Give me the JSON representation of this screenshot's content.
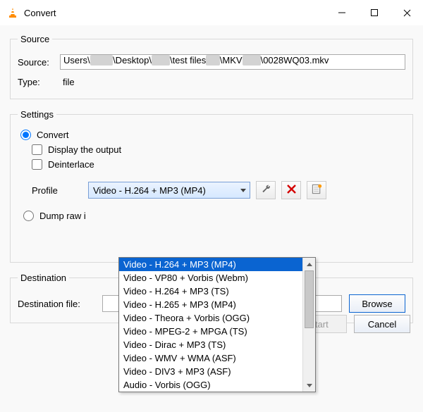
{
  "window": {
    "title": "Convert"
  },
  "source": {
    "legend": "Source",
    "label": "Source:",
    "path_prefix": "Users\\",
    "path_mid1": "\\Desktop\\",
    "path_mid2": "\\test files",
    "path_mid3": "\\MKV",
    "path_tail": "\\0028WQ03.mkv",
    "type_label": "Type:",
    "type_value": "file"
  },
  "settings": {
    "legend": "Settings",
    "convert_label": "Convert",
    "display_output_label": "Display the output",
    "deinterlace_label": "Deinterlace",
    "profile_label": "Profile",
    "profile_selected": "Video - H.264 + MP3 (MP4)",
    "dump_raw_label": "Dump raw i",
    "tool_icon": "wrench",
    "delete_icon": "delete-x",
    "new_icon": "new-profile"
  },
  "dropdown_items": [
    "Video - H.264 + MP3 (MP4)",
    "Video - VP80 + Vorbis (Webm)",
    "Video - H.264 + MP3 (TS)",
    "Video - H.265 + MP3 (MP4)",
    "Video - Theora + Vorbis (OGG)",
    "Video - MPEG-2 + MPGA (TS)",
    "Video - Dirac + MP3 (TS)",
    "Video - WMV + WMA (ASF)",
    "Video - DIV3 + MP3 (ASF)",
    "Audio - Vorbis (OGG)"
  ],
  "destination": {
    "legend": "Destination",
    "label": "Destination file:",
    "browse_label": "Browse"
  },
  "footer": {
    "start_label": "Start",
    "cancel_label": "Cancel"
  }
}
